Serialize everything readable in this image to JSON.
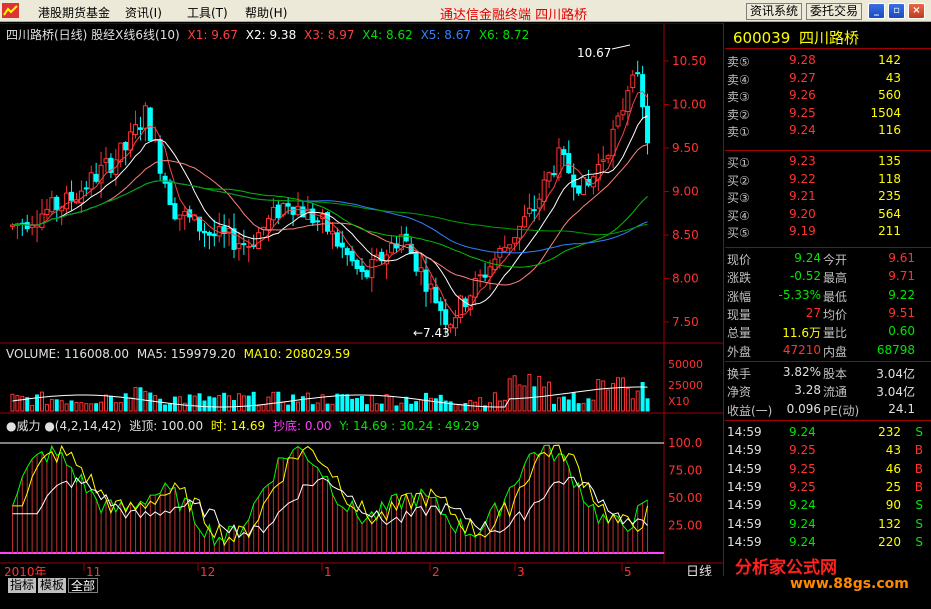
{
  "menu": {
    "items": [
      "港股期货基金",
      "资讯(I)",
      "工具(T)",
      "帮助(H)"
    ],
    "center_title": "通达信金融终端  四川路桥",
    "buttons": [
      "资讯系统",
      "委托交易"
    ]
  },
  "chart_header": {
    "title": "四川路桥(日线) 股经X线6线(10)",
    "ma": [
      {
        "label": "X1: 9.67",
        "color": "#ff4040"
      },
      {
        "label": "X2: 9.38",
        "color": "#ffffff"
      },
      {
        "label": "X3: 8.97",
        "color": "#ff4040"
      },
      {
        "label": "X4: 8.62",
        "color": "#00e000"
      },
      {
        "label": "X5: 8.67",
        "color": "#3080ff"
      },
      {
        "label": "X6: 8.72",
        "color": "#00e000"
      }
    ]
  },
  "price_axis": [
    "10.50",
    "10.00",
    "9.50",
    "9.00",
    "8.50",
    "8.00",
    "7.50"
  ],
  "annotations": {
    "high": "10.67",
    "low": "7.43"
  },
  "volume_header": {
    "volume": "VOLUME: 116008.00",
    "ma5": "MA5: 159979.20",
    "ma10": "MA10: 208029.59"
  },
  "volume_axis": [
    "50000",
    "25000",
    "X10"
  ],
  "indicator_header": {
    "name": "●威力",
    "params": "●(4,2,14,42)",
    "escape_label": "逃顶: 100.00",
    "time_label": "时: 14.69",
    "bottom_label": "抄底: 0.00",
    "y_label": "Y: 14.69 : 30.24 : 49.29"
  },
  "indicator_axis": [
    "100.0",
    "75.00",
    "50.00",
    "25.00"
  ],
  "time_axis": {
    "year": "2010年",
    "months": [
      "11",
      "12",
      "1",
      "2",
      "3",
      "5"
    ]
  },
  "period_label": "日线",
  "tabs": [
    "指标",
    "模板",
    "全部"
  ],
  "quote": {
    "code": "600039",
    "name": "四川路桥",
    "sell": [
      {
        "label": "卖⑤",
        "price": "9.28",
        "vol": "142"
      },
      {
        "label": "卖④",
        "price": "9.27",
        "vol": "43"
      },
      {
        "label": "卖③",
        "price": "9.26",
        "vol": "560"
      },
      {
        "label": "卖②",
        "price": "9.25",
        "vol": "1504"
      },
      {
        "label": "卖①",
        "price": "9.24",
        "vol": "116"
      }
    ],
    "buy": [
      {
        "label": "买①",
        "price": "9.23",
        "vol": "135"
      },
      {
        "label": "买②",
        "price": "9.22",
        "vol": "118"
      },
      {
        "label": "买③",
        "price": "9.21",
        "vol": "235"
      },
      {
        "label": "买④",
        "price": "9.20",
        "vol": "564"
      },
      {
        "label": "买⑤",
        "price": "9.19",
        "vol": "211"
      }
    ],
    "stats": [
      {
        "l1": "现价",
        "v1": "9.24",
        "c1": "green",
        "l2": "今开",
        "v2": "9.61",
        "c2": "red"
      },
      {
        "l1": "涨跌",
        "v1": "-0.52",
        "c1": "green",
        "l2": "最高",
        "v2": "9.71",
        "c2": "red"
      },
      {
        "l1": "涨幅",
        "v1": "-5.33%",
        "c1": "green",
        "l2": "最低",
        "v2": "9.22",
        "c2": "green"
      },
      {
        "l1": "现量",
        "v1": "27",
        "c1": "red",
        "l2": "均价",
        "v2": "9.51",
        "c2": "red"
      },
      {
        "l1": "总量",
        "v1": "11.6万",
        "c1": "yellow",
        "l2": "量比",
        "v2": "0.60",
        "c2": "green"
      },
      {
        "l1": "外盘",
        "v1": "47210",
        "c1": "red",
        "l2": "内盘",
        "v2": "68798",
        "c2": "green"
      }
    ],
    "stats2": [
      {
        "l1": "换手",
        "v1": "3.82%",
        "l2": "股本",
        "v2": "3.04亿"
      },
      {
        "l1": "净资",
        "v1": "3.28",
        "l2": "流通",
        "v2": "3.04亿"
      },
      {
        "l1": "收益(一)",
        "v1": "0.096",
        "l2": "PE(动)",
        "v2": "24.1"
      }
    ],
    "ticks": [
      {
        "time": "14:59",
        "price": "9.24",
        "vol": "232",
        "side": "S"
      },
      {
        "time": "14:59",
        "price": "9.25",
        "vol": "43",
        "side": "B"
      },
      {
        "time": "14:59",
        "price": "9.25",
        "vol": "46",
        "side": "B"
      },
      {
        "time": "14:59",
        "price": "9.25",
        "vol": "25",
        "side": "B"
      },
      {
        "time": "14:59",
        "price": "9.24",
        "vol": "90",
        "side": "S"
      },
      {
        "time": "14:59",
        "price": "9.24",
        "vol": "132",
        "side": "S"
      },
      {
        "time": "14:59",
        "price": "9.24",
        "vol": "220",
        "side": "S"
      }
    ]
  },
  "watermark": {
    "main": "分析家公式网",
    "url": "www.88gs.com"
  },
  "colors": {
    "up": "#ff3232",
    "down": "#00ffff",
    "bg": "#000000",
    "grid": "#a00000"
  }
}
